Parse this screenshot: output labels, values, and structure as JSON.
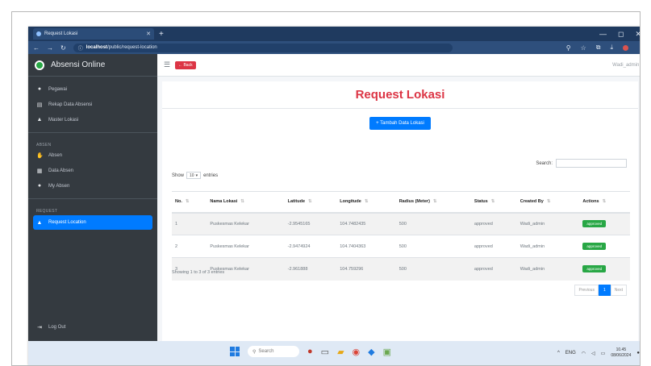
{
  "browser": {
    "tab_title": "Request Lokasi",
    "url_host": "localhost",
    "url_path": "/public/request-location"
  },
  "sidebar": {
    "brand": "Absensi Online",
    "items_top": [
      {
        "label": "Pegawai",
        "icon": "user-icon"
      },
      {
        "label": "Rekap Data Absensi",
        "icon": "file-icon"
      },
      {
        "label": "Master Lokasi",
        "icon": "users-icon"
      }
    ],
    "section_absen": "ABSEN",
    "items_absen": [
      {
        "label": "Absen",
        "icon": "hand-icon"
      },
      {
        "label": "Data Absen",
        "icon": "table-icon"
      },
      {
        "label": "My Absen",
        "icon": "user-icon"
      }
    ],
    "section_request": "REQUEST",
    "active_item": "Request Location",
    "logout": "Log Out"
  },
  "topnav": {
    "back_label": "Back",
    "user": "Wadi_admin"
  },
  "main": {
    "title": "Request Lokasi",
    "add_button": "+ Tambah Data Lokasi",
    "search_label": "Search:",
    "show_label": "Show",
    "entries_value": "10",
    "entries_label": "entries",
    "columns": [
      "No.",
      "Nama Lokasi",
      "Latitude",
      "Longitude",
      "Radius (Meter)",
      "Status",
      "Created By",
      "Actions"
    ],
    "rows": [
      {
        "no": "1",
        "nama": "Puskesmas Kelekar",
        "lat": "-2.9545165",
        "lng": "104.7482435",
        "radius": "500",
        "status": "approved",
        "created_by": "Wadi_admin",
        "action": "approved"
      },
      {
        "no": "2",
        "nama": "Puskesmas Kelekar",
        "lat": "-2.9474924",
        "lng": "104.7404363",
        "radius": "500",
        "status": "approved",
        "created_by": "Wadi_admin",
        "action": "approved"
      },
      {
        "no": "3",
        "nama": "Puskesmas Kelekar",
        "lat": "-2.961888",
        "lng": "104.759296",
        "radius": "500",
        "status": "approved",
        "created_by": "Wadi_admin",
        "action": "approved"
      }
    ],
    "info": "Showing 1 to 3 of 3 entries",
    "pager": {
      "previous": "Previous",
      "current": "1",
      "next": "Next"
    }
  },
  "taskbar": {
    "search_placeholder": "Search",
    "lang": "ENG",
    "time": "10.45",
    "date": "08/06/2024"
  },
  "colors": {
    "sidebar": "#343a40",
    "primary": "#007bff",
    "danger": "#dc3545",
    "success": "#28a745"
  }
}
